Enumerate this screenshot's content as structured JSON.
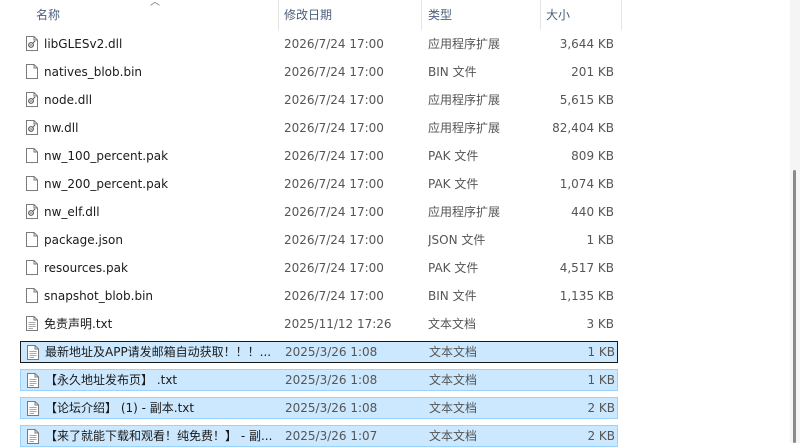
{
  "columns": {
    "name": "名称",
    "modified": "修改日期",
    "type": "类型",
    "size": "大小"
  },
  "files": [
    {
      "name": "libGLESv2.dll",
      "modified": "2026/7/24 17:00",
      "type": "应用程序扩展",
      "size": "3,644 KB",
      "icon": "dll-file-icon",
      "state": "normal"
    },
    {
      "name": "natives_blob.bin",
      "modified": "2026/7/24 17:00",
      "type": "BIN 文件",
      "size": "201 KB",
      "icon": "blank-file-icon",
      "state": "normal"
    },
    {
      "name": "node.dll",
      "modified": "2026/7/24 17:00",
      "type": "应用程序扩展",
      "size": "5,615 KB",
      "icon": "dll-file-icon",
      "state": "normal"
    },
    {
      "name": "nw.dll",
      "modified": "2026/7/24 17:00",
      "type": "应用程序扩展",
      "size": "82,404 KB",
      "icon": "dll-file-icon",
      "state": "normal"
    },
    {
      "name": "nw_100_percent.pak",
      "modified": "2026/7/24 17:00",
      "type": "PAK 文件",
      "size": "809 KB",
      "icon": "blank-file-icon",
      "state": "normal"
    },
    {
      "name": "nw_200_percent.pak",
      "modified": "2026/7/24 17:00",
      "type": "PAK 文件",
      "size": "1,074 KB",
      "icon": "blank-file-icon",
      "state": "normal"
    },
    {
      "name": "nw_elf.dll",
      "modified": "2026/7/24 17:00",
      "type": "应用程序扩展",
      "size": "440 KB",
      "icon": "dll-file-icon",
      "state": "normal"
    },
    {
      "name": "package.json",
      "modified": "2026/7/24 17:00",
      "type": "JSON 文件",
      "size": "1 KB",
      "icon": "blank-file-icon",
      "state": "normal"
    },
    {
      "name": "resources.pak",
      "modified": "2026/7/24 17:00",
      "type": "PAK 文件",
      "size": "4,517 KB",
      "icon": "blank-file-icon",
      "state": "normal"
    },
    {
      "name": "snapshot_blob.bin",
      "modified": "2026/7/24 17:00",
      "type": "BIN 文件",
      "size": "1,135 KB",
      "icon": "blank-file-icon",
      "state": "normal"
    },
    {
      "name": "免责声明.txt",
      "modified": "2025/11/12 17:26",
      "type": "文本文档",
      "size": "3 KB",
      "icon": "text-file-icon",
      "state": "normal"
    },
    {
      "name": "最新地址及APP请发邮箱自动获取！！！...",
      "modified": "2025/3/26 1:08",
      "type": "文本文档",
      "size": "1 KB",
      "icon": "text-file-icon",
      "state": "focus"
    },
    {
      "name": "【永久地址发布页】 .txt",
      "modified": "2025/3/26 1:08",
      "type": "文本文档",
      "size": "1 KB",
      "icon": "text-file-icon",
      "state": "sel"
    },
    {
      "name": "【论坛介绍】 (1) - 副本.txt",
      "modified": "2025/3/26 1:08",
      "type": "文本文档",
      "size": "2 KB",
      "icon": "text-file-icon",
      "state": "sel"
    },
    {
      "name": "【来了就能下载和观看！纯免费！】 - 副...",
      "modified": "2025/3/26 1:07",
      "type": "文本文档",
      "size": "2 KB",
      "icon": "text-file-icon",
      "state": "sel"
    }
  ]
}
